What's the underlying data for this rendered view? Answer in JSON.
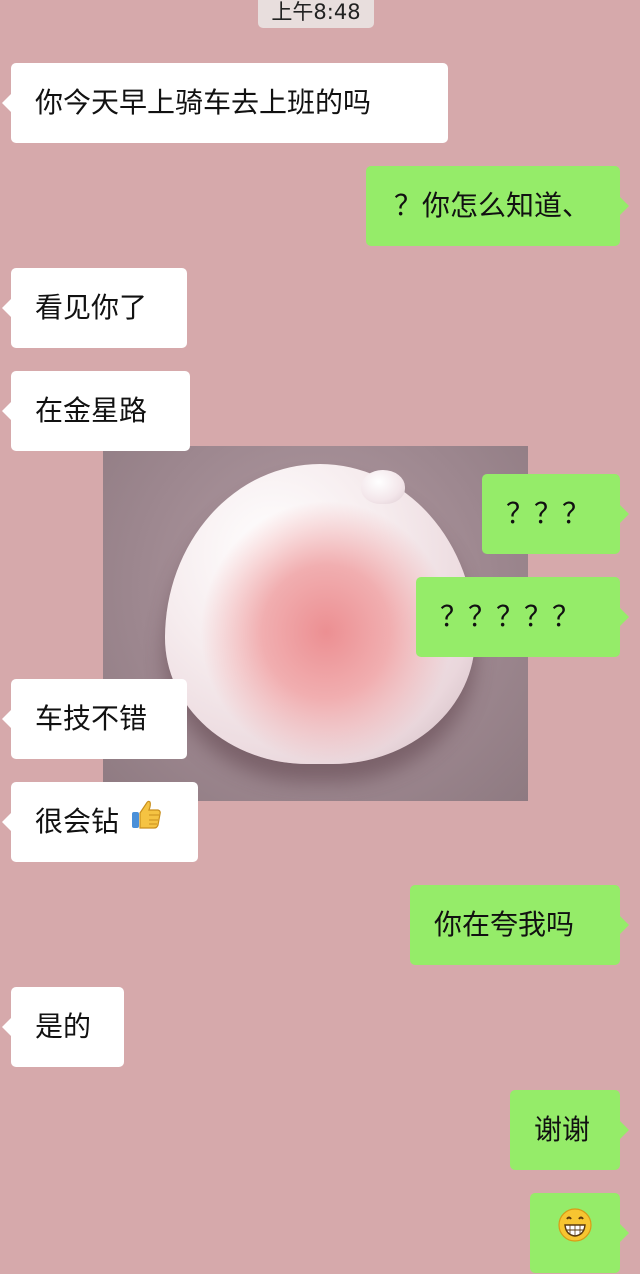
{
  "timestamp": "上午8:48",
  "messages": [
    {
      "side": "left",
      "text": "你今天早上骑车去上班的吗"
    },
    {
      "side": "right",
      "text": "？你怎么知道、"
    },
    {
      "side": "left",
      "text": "看见你了"
    },
    {
      "side": "left",
      "text": "在金星路"
    },
    {
      "side": "right",
      "text": "？？？"
    },
    {
      "side": "right",
      "text": "？？？？？"
    },
    {
      "side": "left",
      "text": "车技不错"
    },
    {
      "side": "left",
      "text": "很会钻",
      "emoji": "thumbs-up-emoji"
    },
    {
      "side": "right",
      "text": "你在夸我吗"
    },
    {
      "side": "left",
      "text": "是的"
    },
    {
      "side": "right",
      "text": "谢谢"
    },
    {
      "side": "right",
      "text": "",
      "emoji": "grinning-face-emoji"
    }
  ],
  "photo": {
    "subject": "peach-bun"
  },
  "colors": {
    "background": "#d6a9ab",
    "incoming_bubble": "#ffffff",
    "outgoing_bubble": "#95ec69"
  }
}
